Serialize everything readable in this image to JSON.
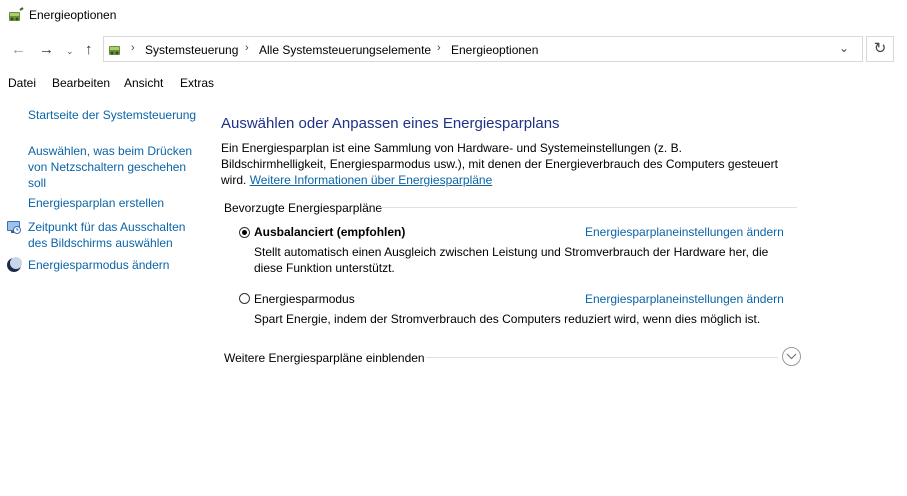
{
  "window": {
    "title": "Energieoptionen",
    "icon": "power-options-icon"
  },
  "nav": {
    "back_icon": "back-arrow-icon",
    "forward_icon": "forward-arrow-icon",
    "recent_icon": "chevron-down-icon",
    "up_icon": "up-arrow-icon",
    "refresh_icon": "refresh-icon",
    "breadcrumb": [
      "Systemsteuerung",
      "Alle Systemsteuerungselemente",
      "Energieoptionen"
    ]
  },
  "menu": [
    "Datei",
    "Bearbeiten",
    "Ansicht",
    "Extras"
  ],
  "sidebar": {
    "items": [
      {
        "label": "Startseite der Systemsteuerung"
      },
      {
        "label": "Auswählen, was beim Drücken von Netzschaltern geschehen soll"
      },
      {
        "label": "Energiesparplan erstellen"
      },
      {
        "label": "Zeitpunkt für das Ausschalten des Bildschirms auswählen",
        "icon": "display-timeout-icon"
      },
      {
        "label": "Energiesparmodus ändern",
        "icon": "sleep-moon-icon"
      }
    ]
  },
  "main": {
    "title": "Auswählen oder Anpassen eines Energiesparplans",
    "description": "Ein Energiesparplan ist eine Sammlung von Hardware- und Systemeinstellungen (z. B. Bildschirmhelligkeit, Energiesparmodus usw.), mit denen der Energieverbrauch des Computers gesteuert wird.",
    "more_info_link": "Weitere Informationen über Energiesparpläne",
    "section_label": "Bevorzugte Energiesparpläne",
    "plans": [
      {
        "name": "Ausbalanciert (empfohlen)",
        "selected": true,
        "settings_link": "Energiesparplaneinstellungen ändern",
        "description": "Stellt automatisch einen Ausgleich zwischen Leistung und Stromverbrauch der Hardware her, die diese Funktion unterstützt."
      },
      {
        "name": "Energiesparmodus",
        "selected": false,
        "settings_link": "Energiesparplaneinstellungen ändern",
        "description": "Spart Energie, indem der Stromverbrauch des Computers reduziert wird, wenn dies möglich ist."
      }
    ],
    "more_plans_label": "Weitere Energiesparpläne einblenden",
    "expand_icon": "chevron-down-circle-icon"
  }
}
